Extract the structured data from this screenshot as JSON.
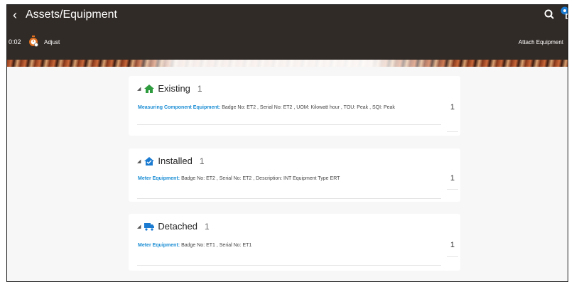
{
  "header": {
    "title": "Assets/Equipment",
    "timer": "0:02",
    "adjust_label": "Adjust",
    "attach_label": "Attach Equipment"
  },
  "colors": {
    "header_bg": "#312b27",
    "accent": "#1a8dd4",
    "icon_green": "#2e9b3e",
    "icon_blue": "#1b7bd1",
    "timer_orange": "#e07020"
  },
  "sections": [
    {
      "title": "Existing",
      "count": "1",
      "icon": "house-icon",
      "row": {
        "link": "Measuring Component Equipment:",
        "text": " Badge No: ET2 , Serial No: ET2 , UOM: Kilowatt hour , TOU: Peak , SQI: Peak",
        "count": "1"
      }
    },
    {
      "title": "Installed",
      "count": "1",
      "icon": "installed-house-icon",
      "row": {
        "link": "Meter Equipment:",
        "text": " Badge No: ET2 , Serial No: ET2 , Description: INT Equipment Type ERT",
        "count": "1"
      }
    },
    {
      "title": "Detached",
      "count": "1",
      "icon": "truck-icon",
      "row": {
        "link": "Meter Equipment:",
        "text": " Badge No: ET1 , Serial No: ET1",
        "count": "1"
      }
    }
  ]
}
